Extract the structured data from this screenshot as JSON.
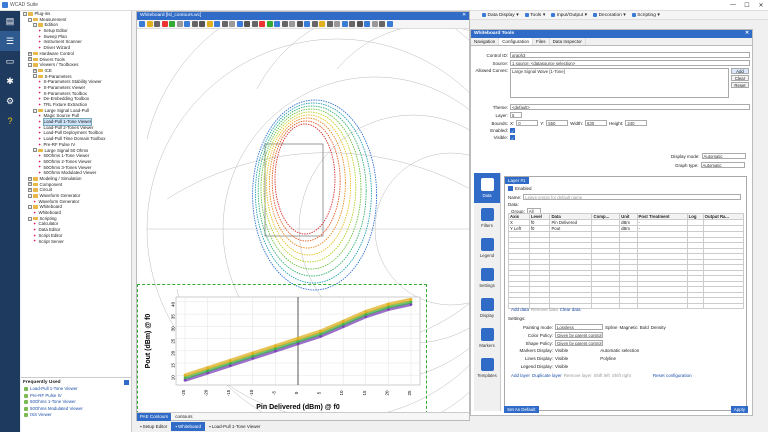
{
  "app": {
    "title": "WCAD Suite"
  },
  "titlebar": {
    "minimize": "—",
    "maximize": "☐",
    "close": "✕"
  },
  "sidebar_icons": [
    "document-icon",
    "menu-icon",
    "slides-icon",
    "bug-icon",
    "gear-icon",
    "help-icon"
  ],
  "tree": [
    {
      "d": 0,
      "t": "Plug-ins",
      "tog": "-"
    },
    {
      "d": 1,
      "t": "Measurement",
      "tog": "-"
    },
    {
      "d": 2,
      "t": "Edition",
      "tog": "-"
    },
    {
      "d": 3,
      "t": "Setup Editor",
      "leaf": 1
    },
    {
      "d": 3,
      "t": "Sweep Plan",
      "leaf": 1
    },
    {
      "d": 3,
      "t": "Instrument Scanner",
      "leaf": 1
    },
    {
      "d": 3,
      "t": "Driver Wizard",
      "leaf": 1
    },
    {
      "d": 1,
      "t": "Hardware Control",
      "tog": "+"
    },
    {
      "d": 1,
      "t": "Drivers Tools",
      "tog": "+"
    },
    {
      "d": 1,
      "t": "Viewers / Toolboxes",
      "tog": "-"
    },
    {
      "d": 2,
      "t": "ICE",
      "tog": "+"
    },
    {
      "d": 2,
      "t": "S-Parameters",
      "tog": "-"
    },
    {
      "d": 3,
      "t": "S-Parameters Stability Viewer",
      "leaf": 1
    },
    {
      "d": 3,
      "t": "S-Parameters Viewer",
      "leaf": 1
    },
    {
      "d": 3,
      "t": "S-Parameters Toolbox",
      "leaf": 1
    },
    {
      "d": 3,
      "t": "De-Embedding Toolbox",
      "leaf": 1
    },
    {
      "d": 3,
      "t": "TRL Fixture Extraction",
      "leaf": 1
    },
    {
      "d": 2,
      "t": "Large Signal Load-Pull",
      "tog": "-"
    },
    {
      "d": 3,
      "t": "Magic Source Pull",
      "leaf": 1
    },
    {
      "d": 3,
      "t": "Load-Pull 1-Tone Viewer",
      "leaf": 1,
      "sel": 1
    },
    {
      "d": 3,
      "t": "Load-Pull 2-Tones Viewer",
      "leaf": 1
    },
    {
      "d": 3,
      "t": "Load-Pull Deployment Toolbox",
      "leaf": 1
    },
    {
      "d": 3,
      "t": "Load-Pull Time Domain Toolbox",
      "leaf": 1
    },
    {
      "d": 3,
      "t": "Pre-RF Pulse IV",
      "leaf": 1
    },
    {
      "d": 2,
      "t": "Large Signal 50 Ohms",
      "tog": "-"
    },
    {
      "d": 3,
      "t": "50Ohms 1-Tone Viewer",
      "leaf": 1
    },
    {
      "d": 3,
      "t": "50Ohms 2-Tones Viewer",
      "leaf": 1
    },
    {
      "d": 3,
      "t": "50Ohms 3-Tones Viewer",
      "leaf": 1
    },
    {
      "d": 3,
      "t": "50Ohms Modulated Viewer",
      "leaf": 1
    },
    {
      "d": 1,
      "t": "Modeling / Simulation",
      "tog": "+"
    },
    {
      "d": 1,
      "t": "Component",
      "tog": "+"
    },
    {
      "d": 1,
      "t": "Circuit",
      "tog": "+"
    },
    {
      "d": 1,
      "t": "Waveform Generator",
      "tog": "-"
    },
    {
      "d": 2,
      "t": "Waveform Generator",
      "leaf": 1
    },
    {
      "d": 1,
      "t": "Whiteboard",
      "tog": "-"
    },
    {
      "d": 2,
      "t": "Whiteboard",
      "leaf": 1
    },
    {
      "d": 1,
      "t": "Scripting",
      "tog": "-"
    },
    {
      "d": 2,
      "t": "Calculator",
      "leaf": 1
    },
    {
      "d": 2,
      "t": "Data Editor",
      "leaf": 1
    },
    {
      "d": 2,
      "t": "Script Editor",
      "leaf": 1
    },
    {
      "d": 2,
      "t": "Script Server",
      "leaf": 1
    }
  ],
  "frequent": {
    "title": "Frequently Used",
    "items": [
      "Load-Pull 1-Tone Viewer",
      "Pre-RF Pulse IV",
      "50Ohms 1-Tone Viewer",
      "50Ohms Modulated Viewer",
      "ISS Viewer"
    ]
  },
  "whiteboard": {
    "title": "Whiteboard [lsl_contours.wc]",
    "close": "✕",
    "bottom_tab_active": "PAE Contours",
    "bottom_tab": "contours"
  },
  "topmenu": [
    "Data Display",
    "Tools",
    "Input/Output",
    "Decoration",
    "Scripting"
  ],
  "tools": {
    "title": "Whiteboard Tools",
    "tabs": [
      "Navigation",
      "Configuration",
      "Files",
      "Data Inspector"
    ],
    "control_id_label": "Control ID:",
    "control_id": "graph3",
    "source_label": "Source:",
    "source": "1 source: <datasource selection>",
    "allowed_label": "Allowed Curves:",
    "allowed": "Large Signal Wave [1-Tone]",
    "add": "Add",
    "clear": "Clear",
    "reset": "Reset",
    "theme_label": "Theme:",
    "theme": "<default>",
    "layer_label": "Layer:",
    "layer": "5",
    "bounds_label": "Bounds:",
    "x_label": "X:",
    "x": "0",
    "y_label": "Y:",
    "y": "550",
    "width_label": "Width:",
    "width": "630",
    "height_label": "Height:",
    "height": "240",
    "enabled_label": "Enabled:",
    "visible_label": "Visible:",
    "display_mode_label": "Display mode:",
    "display_mode": "Automatic",
    "graph_type_label": "Graph type:",
    "graph_type": "Automatic",
    "side": [
      "Data",
      "Filters",
      "Legend",
      "Settings",
      "Display",
      "Markers",
      "Templates"
    ],
    "layer_tab": "Layer #1",
    "layer_enabled": "Enabled",
    "name_label": "Name:",
    "name_placeholder": "Leave empty for default name",
    "data_label": "Data:",
    "group_label": "Group:",
    "group": "All",
    "cols": [
      "Axis",
      "Level",
      "Data",
      "Comp...",
      "Unit",
      "Post Treatment",
      "Log",
      "Output Ra..."
    ],
    "rows": [
      [
        "X",
        "f0",
        "Pin Delivered",
        "",
        "dBm",
        "-",
        "",
        ""
      ],
      [
        "Y Left",
        "f0",
        "Pout",
        "",
        "dBm",
        "-",
        "",
        ""
      ]
    ],
    "add_data": "Add data",
    "remove_data": "Remove data",
    "clear_data": "Clear data",
    "settings_label": "Settings:",
    "painting_label": "Painting mode:",
    "painting": "Lossless",
    "spline": "Spline",
    "magnetic": "Magnetic",
    "bold": "Bold",
    "density": "Density",
    "color_label": "Color Policy:",
    "color": "Given by parent control",
    "shape_label": "Shape Policy:",
    "shape": "Given by parent control",
    "markers_label": "Markers Display:",
    "markers": "Visible",
    "auto_sel": "Automatic selection",
    "lines_label": "Lines Display:",
    "lines": "Visible",
    "polyline": "Polyline",
    "legend_label": "Legend Display:",
    "legend": "Visible",
    "add_layer": "Add layer",
    "dup_layer": "Duplicate layer",
    "rem_layer": "Remove layer",
    "shift_left": "Shift left",
    "shift_right": "Shift right",
    "reset_cfg": "Reset configuration",
    "set_default": "Set As Default",
    "apply": "Apply"
  },
  "bottom_tabs": [
    "Setup Editor",
    "Whiteboard",
    "Load-Pull 1-Tone Viewer"
  ],
  "chart_data": {
    "type": "scatter",
    "xlabel": "Pin Delivered (dBm) @ f0",
    "ylabel": "Pout (dBm) @ f0",
    "x_ticks": [
      "-25",
      "-20",
      "-15",
      "-10",
      "-5",
      "0",
      "5",
      "10",
      "15",
      "20",
      "25"
    ],
    "y_ticks": [
      "40",
      "35",
      "30",
      "25",
      "20",
      "15",
      "10"
    ],
    "xlim": [
      -27,
      27
    ],
    "ylim": [
      6,
      42
    ],
    "series": [
      {
        "values_x": [
          -25,
          -20,
          -15,
          -10,
          -5,
          0,
          5,
          10,
          15,
          20,
          25
        ],
        "values_y": [
          8,
          11,
          14,
          17,
          20,
          23,
          26,
          30,
          34,
          37,
          39
        ],
        "color": "#7a3fb8"
      },
      {
        "values_x": [
          -25,
          -20,
          -15,
          -10,
          -5,
          0,
          5,
          10,
          15,
          20,
          25
        ],
        "values_y": [
          9,
          12,
          15,
          18,
          21,
          24,
          27,
          31,
          35,
          38,
          40
        ],
        "color": "#3bb34a"
      },
      {
        "values_x": [
          -25,
          -20,
          -15,
          -10,
          -5,
          0,
          5,
          10,
          15,
          20,
          25
        ],
        "values_y": [
          10,
          13,
          16,
          19,
          22,
          25,
          28,
          32,
          36,
          39,
          41
        ],
        "color": "#e0b020"
      }
    ]
  }
}
